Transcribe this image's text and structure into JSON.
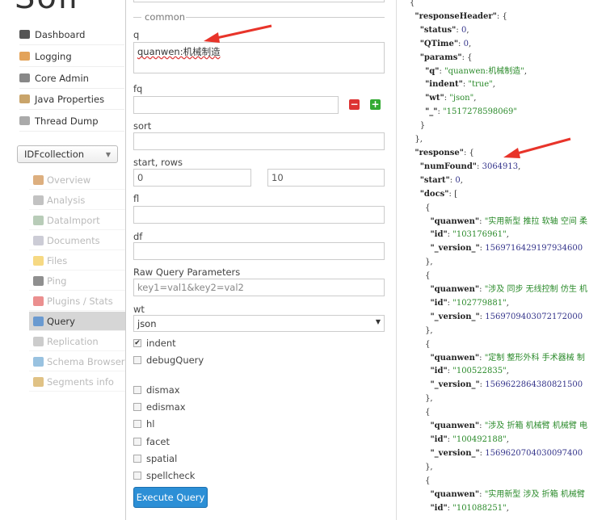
{
  "logo": "Solr",
  "sidebar": {
    "items": [
      {
        "label": "Dashboard",
        "icon": "dashboard-icon",
        "color": "#555"
      },
      {
        "label": "Logging",
        "icon": "logging-icon",
        "color": "#e3a35a"
      },
      {
        "label": "Core Admin",
        "icon": "core-admin-icon",
        "color": "#888"
      },
      {
        "label": "Java Properties",
        "icon": "java-properties-icon",
        "color": "#c9a46a"
      },
      {
        "label": "Thread Dump",
        "icon": "thread-dump-icon",
        "color": "#aaa"
      }
    ],
    "core_selector": "IDFcollection",
    "core_items": [
      {
        "label": "Overview",
        "icon": "home-icon",
        "color": "#c77a2a"
      },
      {
        "label": "Analysis",
        "icon": "funnel-icon",
        "color": "#999"
      },
      {
        "label": "DataImport",
        "icon": "dataimport-icon",
        "color": "#8a8"
      },
      {
        "label": "Documents",
        "icon": "documents-icon",
        "color": "#aab"
      },
      {
        "label": "Files",
        "icon": "folder-icon",
        "color": "#f0c030"
      },
      {
        "label": "Ping",
        "icon": "ping-icon",
        "color": "#444"
      },
      {
        "label": "Plugins / Stats",
        "icon": "plugins-icon",
        "color": "#d44"
      },
      {
        "label": "Query",
        "icon": "magnifier-icon",
        "color": "#6a9ad0",
        "active": true
      },
      {
        "label": "Replication",
        "icon": "replication-icon",
        "color": "#aaa"
      },
      {
        "label": "Schema Browser",
        "icon": "schema-icon",
        "color": "#59c"
      },
      {
        "label": "Segments info",
        "icon": "segments-icon",
        "color": "#c93"
      }
    ]
  },
  "form": {
    "legend": "common",
    "q_label": "q",
    "q_value": "quanwen:机械制造",
    "fq_label": "fq",
    "fq_value": "",
    "sort_label": "sort",
    "sort_value": "",
    "start_rows_label": "start, rows",
    "start_value": "0",
    "rows_value": "10",
    "fl_label": "fl",
    "fl_value": "",
    "df_label": "df",
    "df_value": "",
    "raw_label": "Raw Query Parameters",
    "raw_placeholder": "key1=val1&key2=val2",
    "wt_label": "wt",
    "wt_value": "json",
    "checkboxes": [
      {
        "label": "indent",
        "checked": true
      },
      {
        "label": "debugQuery",
        "checked": false
      },
      {
        "label": "dismax",
        "checked": false
      },
      {
        "label": "edismax",
        "checked": false
      },
      {
        "label": "hl",
        "checked": false
      },
      {
        "label": "facet",
        "checked": false
      },
      {
        "label": "spatial",
        "checked": false
      },
      {
        "label": "spellcheck",
        "checked": false
      }
    ],
    "execute_label": "Execute Query"
  },
  "results": {
    "responseHeader": {
      "status": "0",
      "QTime": "0",
      "params": {
        "q": "quanwen:机械制造",
        "indent": "true",
        "wt": "json",
        "_": "1517278598069"
      }
    },
    "response": {
      "numFound": "3064913",
      "start": "0",
      "docs": [
        {
          "quanwen": "实用新型 推拉 软轴 空间 柔",
          "id": "103176961",
          "_version_": "1569716429197934600"
        },
        {
          "quanwen": "涉及 同步 无线控制 仿生 机",
          "id": "102779881",
          "_version_": "1569709403072172000"
        },
        {
          "quanwen": "定制 整形外科 手术器械 制",
          "id": "100522835",
          "_version_": "1569622864380821500"
        },
        {
          "quanwen": "涉及 折箱 机械臂 机械臂 电",
          "id": "100492188",
          "_version_": "1569620704030097400"
        },
        {
          "quanwen": "实用新型 涉及 折箱 机械臂",
          "id": "101088251"
        }
      ]
    }
  },
  "annotation_color": "#e8342a"
}
